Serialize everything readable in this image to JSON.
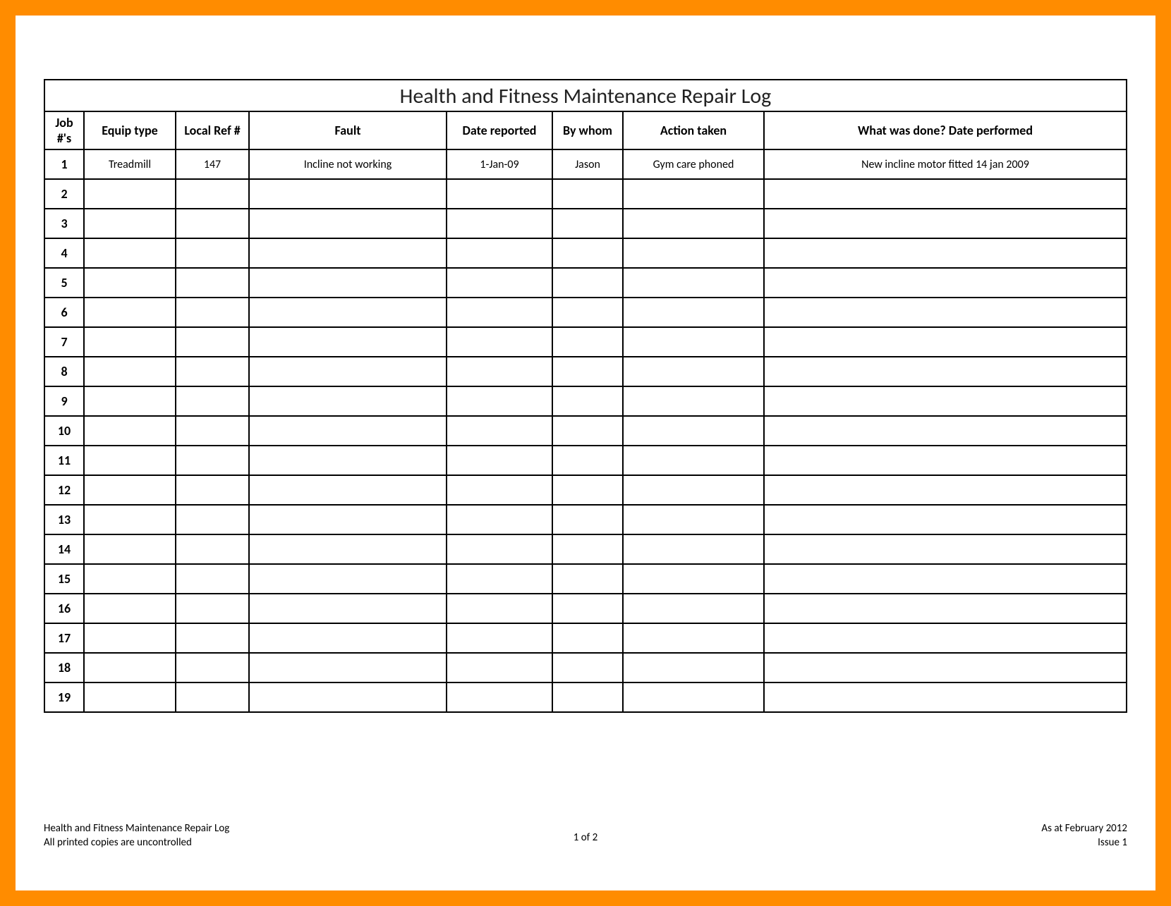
{
  "title": "Health and Fitness Maintenance Repair Log",
  "columns": [
    "Job #'s",
    "Equip type",
    "Local Ref #",
    "Fault",
    "Date reported",
    "By whom",
    "Action taken",
    "What was done? Date performed"
  ],
  "rows": [
    {
      "num": "1",
      "equip": "Treadmill",
      "ref": "147",
      "fault": "Incline not working",
      "date": "1-Jan-09",
      "who": "Jason",
      "action": "Gym care phoned",
      "done": "New incline motor fitted 14 jan 2009"
    },
    {
      "num": "2",
      "equip": "",
      "ref": "",
      "fault": "",
      "date": "",
      "who": "",
      "action": "",
      "done": ""
    },
    {
      "num": "3",
      "equip": "",
      "ref": "",
      "fault": "",
      "date": "",
      "who": "",
      "action": "",
      "done": ""
    },
    {
      "num": "4",
      "equip": "",
      "ref": "",
      "fault": "",
      "date": "",
      "who": "",
      "action": "",
      "done": ""
    },
    {
      "num": "5",
      "equip": "",
      "ref": "",
      "fault": "",
      "date": "",
      "who": "",
      "action": "",
      "done": ""
    },
    {
      "num": "6",
      "equip": "",
      "ref": "",
      "fault": "",
      "date": "",
      "who": "",
      "action": "",
      "done": ""
    },
    {
      "num": "7",
      "equip": "",
      "ref": "",
      "fault": "",
      "date": "",
      "who": "",
      "action": "",
      "done": ""
    },
    {
      "num": "8",
      "equip": "",
      "ref": "",
      "fault": "",
      "date": "",
      "who": "",
      "action": "",
      "done": ""
    },
    {
      "num": "9",
      "equip": "",
      "ref": "",
      "fault": "",
      "date": "",
      "who": "",
      "action": "",
      "done": ""
    },
    {
      "num": "10",
      "equip": "",
      "ref": "",
      "fault": "",
      "date": "",
      "who": "",
      "action": "",
      "done": ""
    },
    {
      "num": "11",
      "equip": "",
      "ref": "",
      "fault": "",
      "date": "",
      "who": "",
      "action": "",
      "done": ""
    },
    {
      "num": "12",
      "equip": "",
      "ref": "",
      "fault": "",
      "date": "",
      "who": "",
      "action": "",
      "done": ""
    },
    {
      "num": "13",
      "equip": "",
      "ref": "",
      "fault": "",
      "date": "",
      "who": "",
      "action": "",
      "done": ""
    },
    {
      "num": "14",
      "equip": "",
      "ref": "",
      "fault": "",
      "date": "",
      "who": "",
      "action": "",
      "done": ""
    },
    {
      "num": "15",
      "equip": "",
      "ref": "",
      "fault": "",
      "date": "",
      "who": "",
      "action": "",
      "done": ""
    },
    {
      "num": "16",
      "equip": "",
      "ref": "",
      "fault": "",
      "date": "",
      "who": "",
      "action": "",
      "done": ""
    },
    {
      "num": "17",
      "equip": "",
      "ref": "",
      "fault": "",
      "date": "",
      "who": "",
      "action": "",
      "done": ""
    },
    {
      "num": "18",
      "equip": "",
      "ref": "",
      "fault": "",
      "date": "",
      "who": "",
      "action": "",
      "done": ""
    },
    {
      "num": "19",
      "equip": "",
      "ref": "",
      "fault": "",
      "date": "",
      "who": "",
      "action": "",
      "done": ""
    }
  ],
  "footer": {
    "left1": "Health and Fitness Maintenance Repair Log",
    "left2": "All printed copies are uncontrolled",
    "center": "1 of 2",
    "right1": "As at February 2012",
    "right2": "Issue 1"
  }
}
